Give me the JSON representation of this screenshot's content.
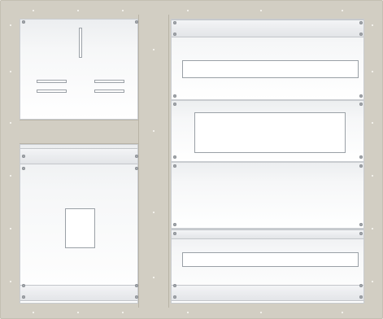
{
  "panel_assembly": {
    "frame": "panel-frame",
    "left_column": [
      "meter-panel",
      "divider-bar",
      "cover-panel-with-window"
    ],
    "right_column": [
      "cover-panel-slot",
      "cover-panel-large-window",
      "blank-panel",
      "cover-panel-slot-bottom"
    ]
  },
  "colors": {
    "frame": "#d2cec3",
    "panel": "#f4f5f6",
    "panel_border": "#c9ccd0",
    "cutout": "#ffffff",
    "screw": "#a9adb2"
  }
}
